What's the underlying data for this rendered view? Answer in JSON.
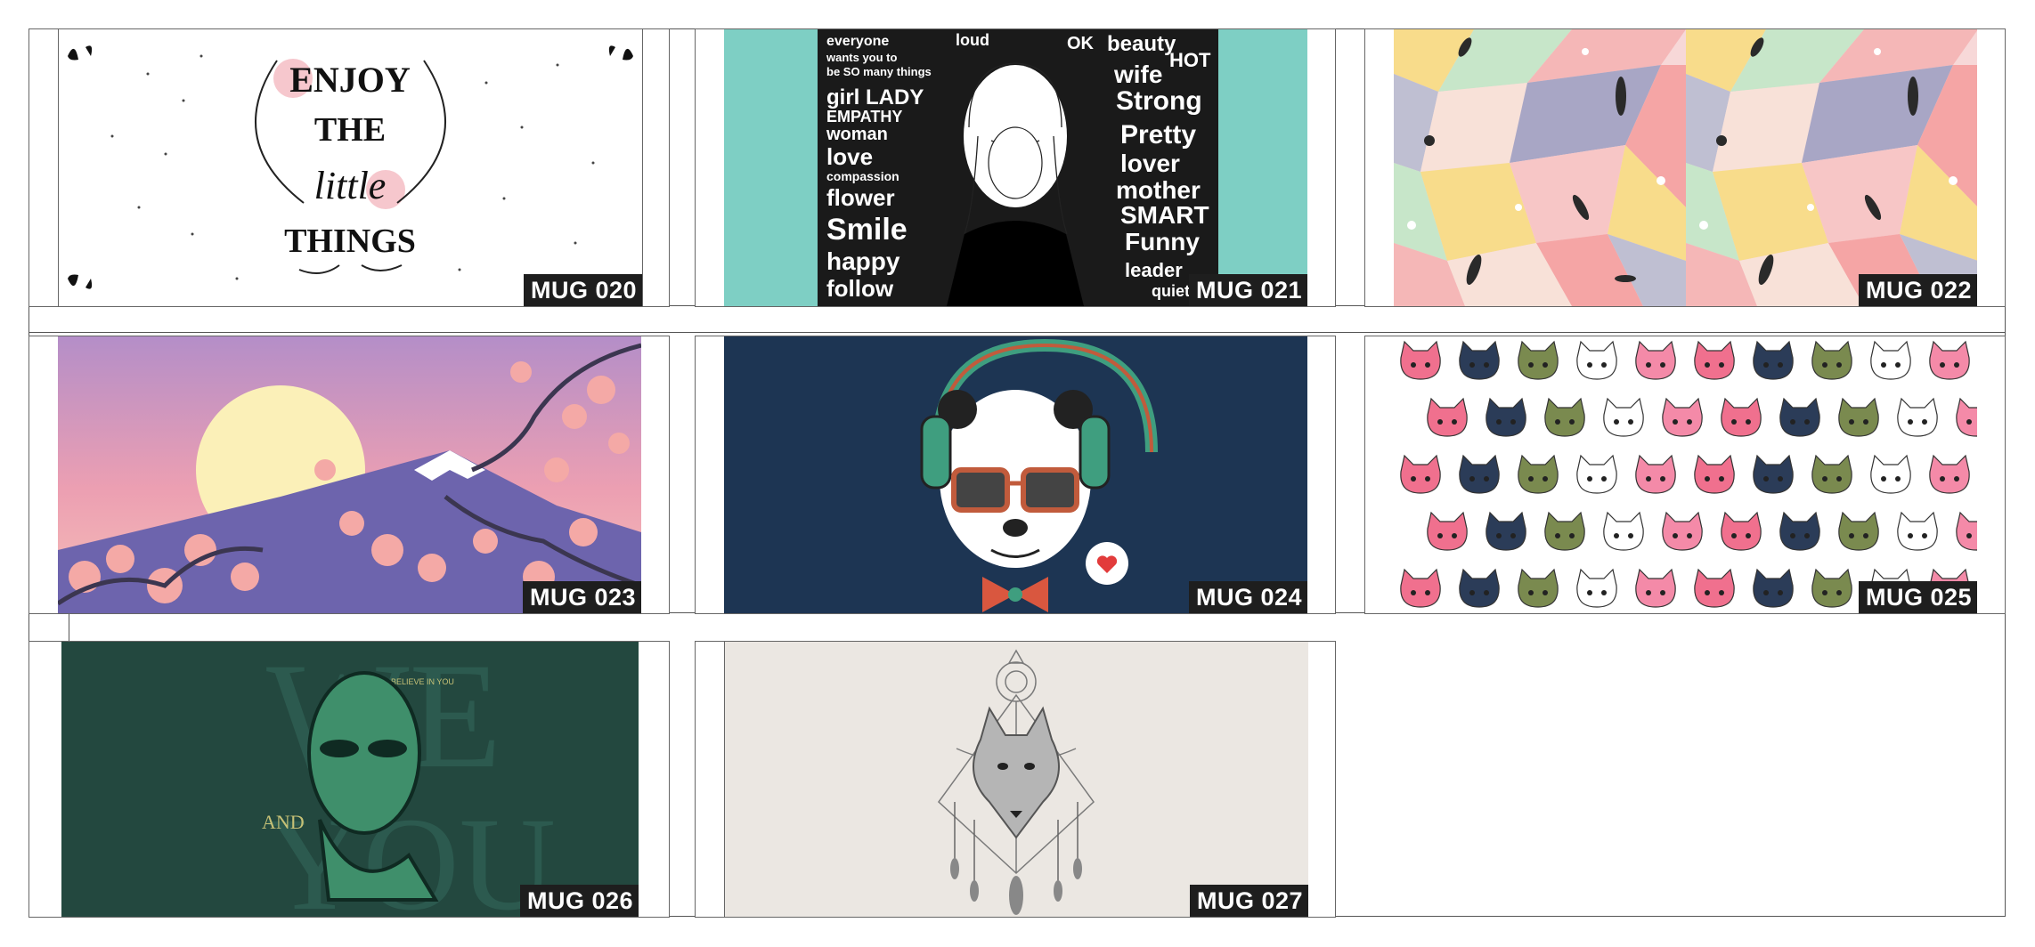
{
  "sheet": {
    "mugs": [
      {
        "code": "MUG 020",
        "text_lines": [
          "ENJOY",
          "THE",
          "little",
          "THINGS"
        ]
      },
      {
        "code": "MUG 021",
        "words_left": [
          "everyone",
          "wants you to",
          "be SO many things",
          "girl LADY",
          "EMPATHY",
          "woman",
          "love",
          "compassion",
          "flower",
          "Smile",
          "happy",
          "follow"
        ],
        "words_right": [
          "loud",
          "OK",
          "beauty",
          "wife",
          "HOT",
          "Strong",
          "Pretty",
          "lover",
          "mother",
          "SMART",
          "Funny",
          "leader",
          "quiet"
        ]
      },
      {
        "code": "MUG 022"
      },
      {
        "code": "MUG 023"
      },
      {
        "code": "MUG 024"
      },
      {
        "code": "MUG 025"
      },
      {
        "code": "MUG 026",
        "small_text": "BELIEVE IN YOU",
        "big_text": [
          "WE",
          "AND",
          "YOU"
        ]
      },
      {
        "code": "MUG 027"
      }
    ]
  },
  "colors": {
    "mug021_bg": "#7ecfc4",
    "mug024_bg": "#1d3553",
    "mug026_bg": "#23483f",
    "mug027_bg": "#ebe7e2",
    "label_bg": "#1e1e1e"
  }
}
